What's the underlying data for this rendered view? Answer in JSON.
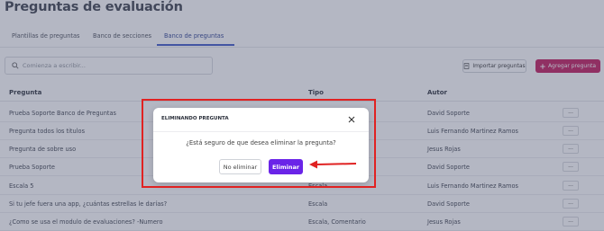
{
  "page": {
    "title": "Preguntas de evaluación"
  },
  "tabs": [
    {
      "label": "Plantillas de preguntas",
      "active": false
    },
    {
      "label": "Banco de secciones",
      "active": false
    },
    {
      "label": "Banco de preguntas",
      "active": true
    }
  ],
  "search": {
    "placeholder": "Comienza a escribir..."
  },
  "toolbar": {
    "import_label": "Importar preguntas",
    "add_label": "Agregar pregunta"
  },
  "table": {
    "headers": [
      "Pregunta",
      "Tipo",
      "Autor"
    ],
    "more_label": "...",
    "rows": [
      {
        "question": "Prueba Soporte Banco de Preguntas",
        "type": "",
        "author": "David Soporte"
      },
      {
        "question": "Pregunta todos los titulos",
        "type": "",
        "author": "Luis Fernando Martinez Ramos"
      },
      {
        "question": "Pregunta de sobre uso",
        "type": "",
        "author": "Jesus Rojas"
      },
      {
        "question": "Prueba Soporte",
        "type": "",
        "author": "David Soporte"
      },
      {
        "question": "Escala 5",
        "type": "Escala",
        "author": "Luis Fernando Martinez Ramos"
      },
      {
        "question": "Si tu jefe fuera una app, ¿cuántas estrellas le darías?",
        "type": "Escala",
        "author": "David Soporte"
      },
      {
        "question": "¿Como se usa el modulo de evaluaciones? -Numero",
        "type": "Escala, Comentario",
        "author": "Jesus Rojas"
      }
    ]
  },
  "modal": {
    "title": "ELIMINANDO PREGUNTA",
    "message": "¿Está seguro de que desea eliminar la pregunta?",
    "cancel_label": "No eliminar",
    "confirm_label": "Eliminar"
  },
  "colors": {
    "accent_pink": "#c2185b",
    "confirm_purple": "#6a24e8",
    "annotation_red": "#e02222",
    "active_tab": "#3d57c7"
  },
  "icons": {
    "search": "search-icon",
    "import": "import-icon",
    "add": "plus-icon",
    "close": "close-icon",
    "arrow": "arrow-left-icon"
  }
}
